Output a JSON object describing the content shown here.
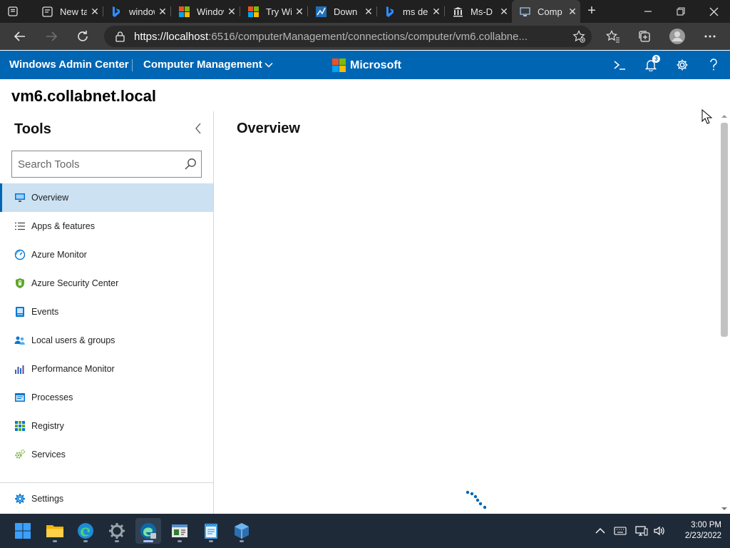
{
  "browser": {
    "tabs": [
      {
        "title": "New tab",
        "icon": "newtab-icon",
        "active": false
      },
      {
        "title": "windows",
        "icon": "bing-icon",
        "active": false
      },
      {
        "title": "Windows",
        "icon": "windows-logo-icon",
        "active": false
      },
      {
        "title": "Try Wi",
        "icon": "windows-logo-icon",
        "active": false
      },
      {
        "title": "Down",
        "icon": "download-page-icon",
        "active": false
      },
      {
        "title": "ms de",
        "icon": "bing-icon",
        "active": false
      },
      {
        "title": "Ms-D",
        "icon": "docs-pillar-icon",
        "active": false
      },
      {
        "title": "Comp",
        "icon": "wac-icon",
        "active": true
      }
    ],
    "url_host": "https://localhost",
    "url_rest": ":6516/computerManagement/connections/computer/vm6.collabne..."
  },
  "header": {
    "app_title": "Windows Admin Center",
    "context": "Computer Management",
    "brand": "Microsoft",
    "notification_count": "3"
  },
  "page": {
    "server_name": "vm6.collabnet.local",
    "main_title": "Overview"
  },
  "tools": {
    "title": "Tools",
    "search_placeholder": "Search Tools",
    "items": [
      {
        "label": "Overview",
        "icon": "overview-monitor-icon",
        "selected": true
      },
      {
        "label": "Apps & features",
        "icon": "list-icon"
      },
      {
        "label": "Azure Monitor",
        "icon": "gauge-icon"
      },
      {
        "label": "Azure Security Center",
        "icon": "shield-icon"
      },
      {
        "label": "Events",
        "icon": "event-log-icon"
      },
      {
        "label": "Local users & groups",
        "icon": "users-icon"
      },
      {
        "label": "Performance Monitor",
        "icon": "bar-chart-icon"
      },
      {
        "label": "Processes",
        "icon": "process-window-icon"
      },
      {
        "label": "Registry",
        "icon": "registry-icon"
      },
      {
        "label": "Services",
        "icon": "gears-icon"
      }
    ],
    "settings_label": "Settings"
  },
  "taskbar": {
    "time": "3:00 PM",
    "date": "2/23/2022"
  },
  "colors": {
    "wac_blue": "#0066b4",
    "selected_row": "#cce1f2",
    "taskbar": "#1f2a38"
  }
}
